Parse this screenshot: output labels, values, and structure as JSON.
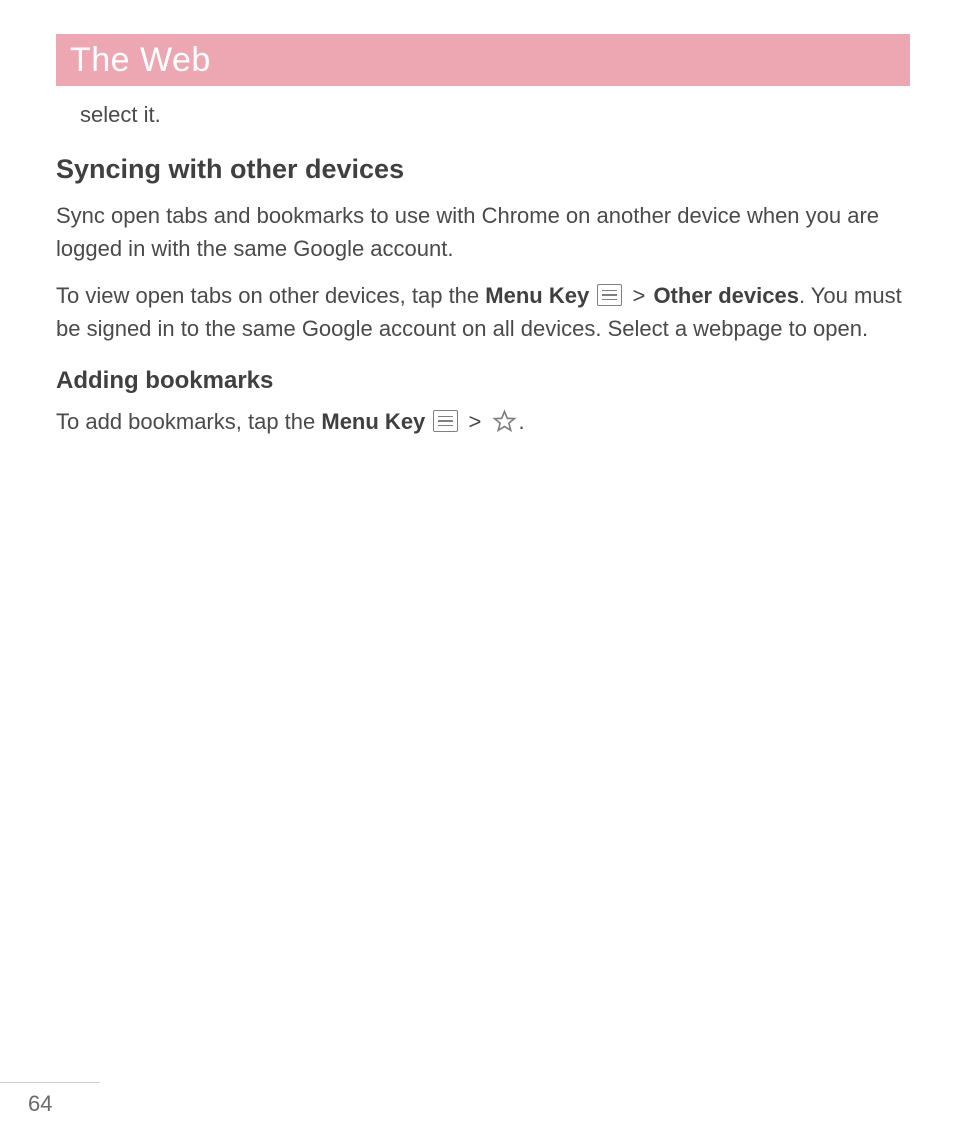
{
  "header": {
    "title": "The Web"
  },
  "continued_text": "select it.",
  "section1": {
    "heading": "Syncing with other devices",
    "para1": "Sync open tabs and bookmarks to use with Chrome on another device when you are logged in with the same Google account.",
    "para2_a": "To view open tabs on other devices, tap the ",
    "menu_key_label": "Menu Key",
    "gt": ">",
    "other_devices_label": "Other devices",
    "para2_b": ". You must be signed in to the same Google account on all devices. Select a webpage to open."
  },
  "section2": {
    "heading": "Adding bookmarks",
    "para_a": "To add bookmarks, tap the ",
    "menu_key_label": "Menu Key",
    "gt": ">",
    "period": "."
  },
  "footer": {
    "page_number": "64"
  }
}
